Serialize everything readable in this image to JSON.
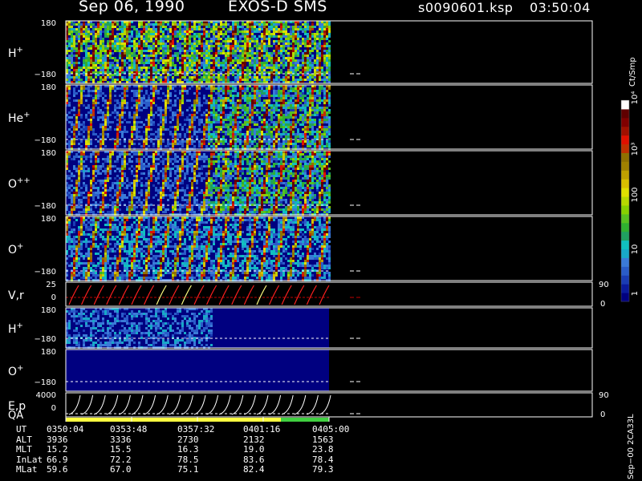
{
  "header": {
    "date": "Sep 06, 1990",
    "title": "EXOS-D SMS",
    "file": "s0090601.ksp",
    "time": "03:50:04"
  },
  "colorbar": {
    "unit": "Ct/Smp",
    "ticks": [
      "1",
      "10",
      "100",
      "10³",
      "10⁴"
    ],
    "colors": [
      "#000080",
      "#0a1a9c",
      "#1a3cb4",
      "#2a5cc8",
      "#3a7ad8",
      "#18a8c8",
      "#10c0c0",
      "#20a060",
      "#30b030",
      "#58c020",
      "#88d000",
      "#b8d800",
      "#e0e000",
      "#d8c000",
      "#c0a000",
      "#a08000",
      "#907000",
      "#c03000",
      "#e01000",
      "#a01000",
      "#800000",
      "#600000",
      "#ffffff"
    ]
  },
  "panels": [
    {
      "label": "H⁺",
      "label_base": "H",
      "label_sup": "+",
      "ymax": "180",
      "ymin": "−180"
    },
    {
      "label": "He⁺",
      "label_base": "He",
      "label_sup": "+",
      "ymax": "180",
      "ymin": "−180"
    },
    {
      "label": "O⁺⁺",
      "label_base": "O",
      "label_sup": "++",
      "ymax": "180",
      "ymin": "−180"
    },
    {
      "label": "O⁺",
      "label_base": "O",
      "label_sup": "+",
      "ymax": "180",
      "ymin": "−180"
    },
    {
      "label": "V,r",
      "label_base": "V,r",
      "label_sup": "",
      "ymax": "25",
      "ymin": "0",
      "right_top": "90",
      "right_bot": "0"
    },
    {
      "label": "H⁺",
      "label_base": "H",
      "label_sup": "+",
      "ymax": "180",
      "ymin": "−180"
    },
    {
      "label": "O⁺",
      "label_base": "O",
      "label_sup": "+",
      "ymax": "180",
      "ymin": "−180"
    },
    {
      "label": "E,p",
      "label_base": "E,p",
      "label_sup": "",
      "ymax": "4000",
      "ymin": "0",
      "right_top": "90",
      "right_bot": "0"
    }
  ],
  "qa_label": "QA",
  "orbit_table": {
    "rows": [
      {
        "name": "UT",
        "values": [
          "0350:04",
          "0353:48",
          "0357:32",
          "0401:16",
          "0405:00"
        ]
      },
      {
        "name": "ALT",
        "values": [
          "3936",
          "3336",
          "2730",
          "2132",
          "1563"
        ]
      },
      {
        "name": "MLT",
        "values": [
          "15.2",
          "15.5",
          "16.3",
          "19.0",
          "23.8"
        ]
      },
      {
        "name": "InLat",
        "values": [
          "66.9",
          "72.2",
          "78.5",
          "83.6",
          "78.4"
        ]
      },
      {
        "name": "MLat",
        "values": [
          "59.6",
          "67.0",
          "75.1",
          "82.4",
          "79.3"
        ]
      }
    ]
  },
  "side_label": "Sep−00 2CA33L",
  "chart_data": {
    "type": "heatmap",
    "x_label": "UT",
    "x_ticks": [
      "0350:04",
      "0353:48",
      "0357:32",
      "0401:16",
      "0405:00"
    ],
    "panels": [
      "H⁺",
      "He⁺",
      "O⁺⁺",
      "O⁺",
      "V,r",
      "H⁺",
      "O⁺",
      "E,p"
    ],
    "y_range_pitch": [
      -180,
      180
    ],
    "colorbar": {
      "unit": "Ct/Smp",
      "scale": "log",
      "range": [
        1,
        10000
      ]
    },
    "data_end_ut": "0405:00",
    "qa_segments": [
      {
        "from": "0350:04",
        "to": "0401:16",
        "color": "#ffff40"
      },
      {
        "from": "0401:16",
        "to": "0405:00",
        "color": "#40d040"
      }
    ]
  }
}
